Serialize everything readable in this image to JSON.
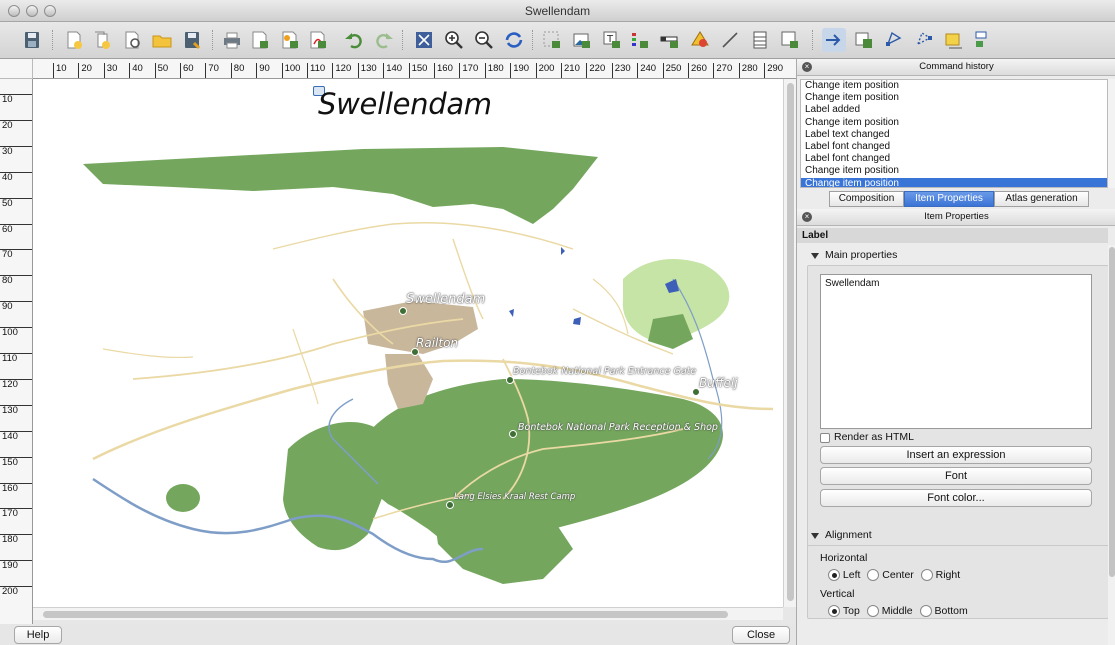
{
  "window": {
    "title": "Swellendam"
  },
  "toolbar": {
    "icons": [
      "save-icon",
      "new-composer-icon",
      "duplicate-composer-icon",
      "composer-manager-icon",
      "open-template-icon",
      "save-template-icon",
      "print-icon",
      "export-image-icon",
      "export-svg-icon",
      "export-pdf-icon",
      "undo-icon",
      "redo-icon",
      "zoom-full-icon",
      "zoom-in-icon",
      "zoom-out-icon",
      "refresh-icon",
      "add-map-icon",
      "add-image-icon",
      "add-label-icon",
      "add-legend-icon",
      "add-scalebar-icon",
      "add-shape-icon",
      "add-arrow-icon",
      "add-table-icon",
      "add-html-icon",
      "select-move-icon",
      "move-content-icon",
      "group-icon",
      "ungroup-icon",
      "raise-icon",
      "align-icon"
    ]
  },
  "rulers": {
    "horizontal": [
      "10",
      "20",
      "30",
      "40",
      "50",
      "60",
      "70",
      "80",
      "90",
      "100",
      "110",
      "120",
      "130",
      "140",
      "150",
      "160",
      "170",
      "180",
      "190",
      "200",
      "210",
      "220",
      "230",
      "240",
      "250",
      "260",
      "270",
      "280",
      "290"
    ],
    "vertical": [
      "10",
      "20",
      "30",
      "40",
      "50",
      "60",
      "70",
      "80",
      "90",
      "100",
      "110",
      "120",
      "130",
      "140",
      "150",
      "160",
      "170",
      "180",
      "190",
      "200"
    ]
  },
  "map": {
    "title": "Swellendam",
    "labels": {
      "swellendam": "Swellendam",
      "railton": "Railton",
      "entrance_gate": "Bontebok National Park Entrance Gate",
      "buffeljagsrivier": "Buffelj",
      "reception": "Bontebok National Park Reception & Shop",
      "rest_camp": "Lang Elsies Kraal Rest Camp"
    },
    "colors": {
      "park": "#74a75d",
      "roads": "#ead9a4",
      "river": "#7f9ec7",
      "urban": "#c9b79c",
      "light_green": "#c5e4a6"
    }
  },
  "buttons": {
    "help": "Help",
    "close": "Close"
  },
  "command_history": {
    "title": "Command history",
    "items": [
      "Change item position",
      "Change item position",
      "Label added",
      "Change item position",
      "Label text changed",
      "Label font changed",
      "Label font changed",
      "Change item position",
      "Change item position"
    ],
    "selected_index": 8
  },
  "tabs": {
    "composition": "Composition",
    "item_properties": "Item Properties",
    "atlas": "Atlas generation",
    "active": "Item Properties"
  },
  "item_properties": {
    "title": "Item Properties",
    "section": "Label",
    "main_properties": {
      "heading": "Main properties",
      "text": "Swellendam",
      "render_html_label": "Render as HTML",
      "render_html_checked": false,
      "insert_expression": "Insert an expression",
      "font": "Font",
      "font_color": "Font color..."
    },
    "alignment": {
      "heading": "Alignment",
      "horizontal_label": "Horizontal",
      "horizontal_options": [
        "Left",
        "Center",
        "Right"
      ],
      "horizontal_selected": "Left",
      "vertical_label": "Vertical",
      "vertical_options": [
        "Top",
        "Middle",
        "Bottom"
      ],
      "vertical_selected": "Top"
    }
  }
}
